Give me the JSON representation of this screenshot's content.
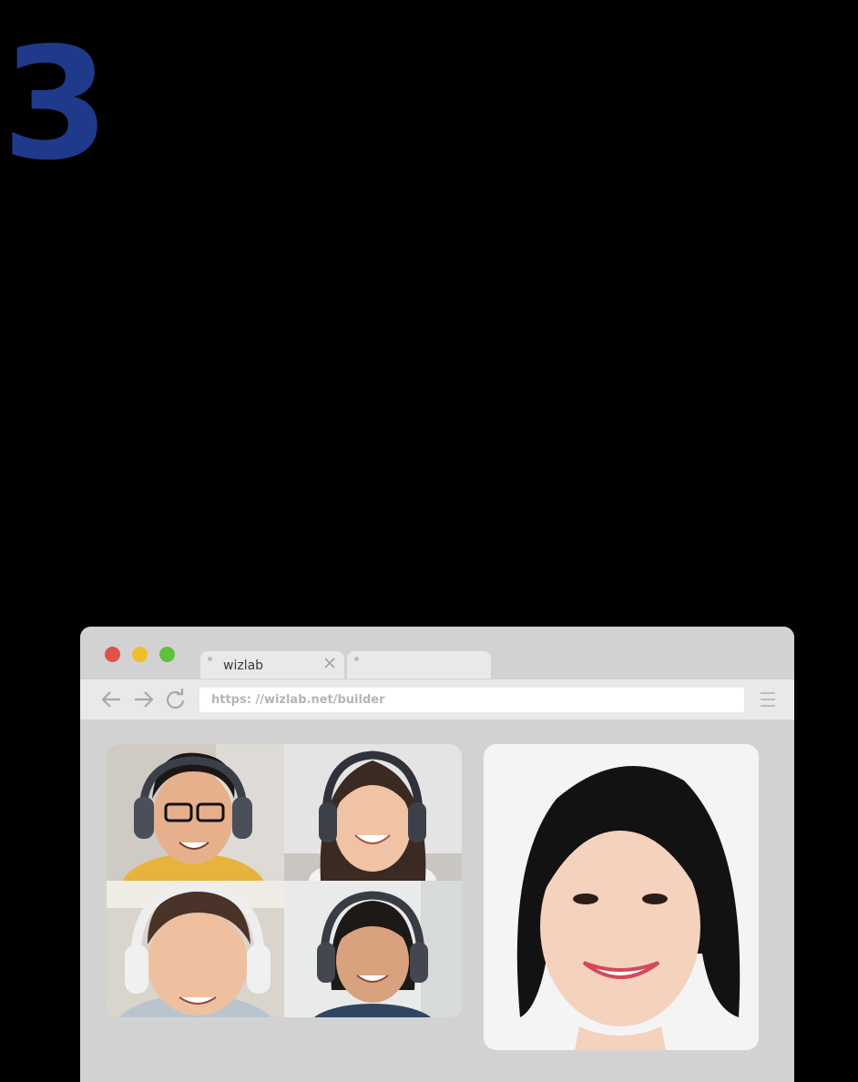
{
  "step": {
    "number": "3"
  },
  "browser": {
    "tabs": [
      {
        "label": "wizlab",
        "active": true
      },
      {
        "label": "",
        "active": false
      }
    ],
    "address": {
      "url": "https: //wizlab.net/builder"
    },
    "window_controls": [
      "close",
      "minimize",
      "maximize"
    ]
  },
  "video_call": {
    "participants": [
      {
        "role": "student",
        "description": "boy with glasses and headphones"
      },
      {
        "role": "student",
        "description": "girl with headphones"
      },
      {
        "role": "student",
        "description": "girl with white headphones"
      },
      {
        "role": "student",
        "description": "girl with headphones"
      }
    ],
    "teacher": {
      "role": "teacher",
      "description": "smiling woman with short black hair"
    }
  },
  "colors": {
    "step_number": "#1f3a8a",
    "close": "#e0514b",
    "minimize": "#f2bd2b",
    "maximize": "#5ec141",
    "chrome": "#d2d2d2",
    "toolbar": "#e9e9e9"
  }
}
